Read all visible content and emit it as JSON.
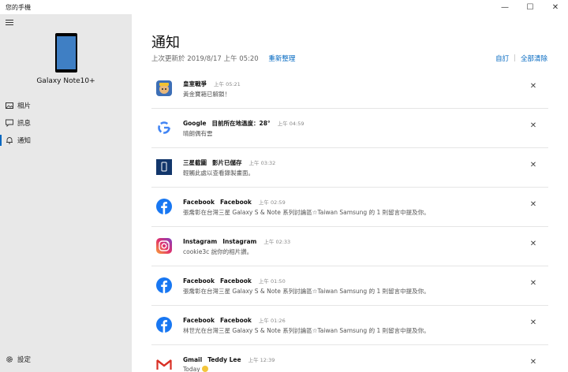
{
  "window": {
    "title": "您的手機",
    "minimize_glyph": "—",
    "maximize_glyph": "☐",
    "close_glyph": "✕"
  },
  "sidebar": {
    "device_name": "Galaxy Note10+",
    "items": [
      {
        "label": "相片",
        "icon": "photo-icon",
        "active": false
      },
      {
        "label": "訊息",
        "icon": "message-icon",
        "active": false
      },
      {
        "label": "通知",
        "icon": "bell-icon",
        "active": true
      }
    ],
    "settings_label": "設定"
  },
  "main": {
    "title": "通知",
    "last_updated": "上次更新於 2019/8/17 上午 05:20",
    "refresh_label": "重新整理",
    "customize_label": "自訂",
    "clear_all_label": "全部清除",
    "notifications": [
      {
        "icon": "clash-royale-icon",
        "app": "皇室戰爭",
        "title": "",
        "time": "上午 05:21",
        "body": "黃金寶箱已解鎖！"
      },
      {
        "icon": "google-icon",
        "app": "Google",
        "title": "目前所在地溫度：28°",
        "time": "上午 04:59",
        "body": "晴朗偶有雲"
      },
      {
        "icon": "screenshot-icon",
        "app": "三星截圖",
        "title": "影片已儲存",
        "time": "上午 03:32",
        "body": "輕觸此處以查看錄製畫面。"
      },
      {
        "icon": "facebook-icon",
        "app": "Facebook",
        "title": "Facebook",
        "time": "上午 02:59",
        "body": "張喬彰在台灣三星 Galaxy S & Note 系列討論區☆Taiwan Samsung 的 1 則留言中提及你。"
      },
      {
        "icon": "instagram-icon",
        "app": "Instagram",
        "title": "Instagram",
        "time": "上午 02:33",
        "body": "cookie3c 說你的相片讚。"
      },
      {
        "icon": "facebook-icon",
        "app": "Facebook",
        "title": "Facebook",
        "time": "上午 01:50",
        "body": "張喬彰在台灣三星 Galaxy S & Note 系列討論區☆Taiwan Samsung 的 1 則留言中提及你。"
      },
      {
        "icon": "facebook-icon",
        "app": "Facebook",
        "title": "Facebook",
        "time": "上午 01:26",
        "body": "林世光在台灣三星 Galaxy S & Note 系列討論區☆Taiwan Samsung 的 1 則留言中提及你。"
      },
      {
        "icon": "gmail-icon",
        "app": "Gmail",
        "title": "Teddy Lee",
        "time": "上午 12:39",
        "body": "Today"
      }
    ],
    "close_glyph": "✕"
  },
  "colors": {
    "accent": "#0067c0",
    "sidebar_bg": "#e8e8e8",
    "facebook": "#1877f2"
  }
}
